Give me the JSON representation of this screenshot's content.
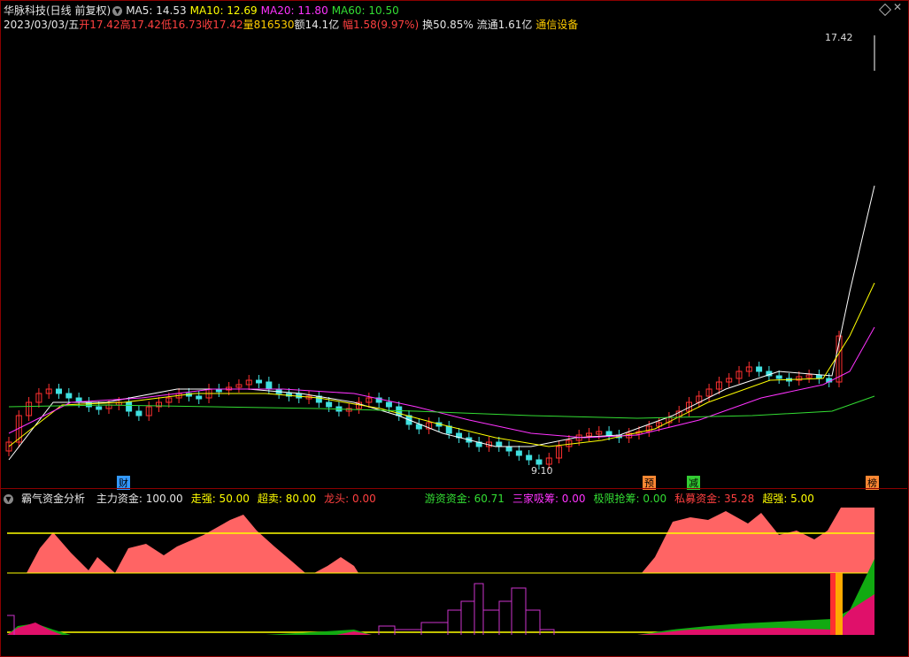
{
  "header": {
    "stock_title": "华脉科技(日线 前复权)",
    "ma5": "MA5: 14.53",
    "ma10": "MA10: 12.69",
    "ma20": "MA20: 11.80",
    "ma60": "MA60: 10.50",
    "date": "2023/03/03/五",
    "open": "开17.42",
    "high": "高17.42",
    "low": "低16.73",
    "close": "收17.42",
    "volume": "量816530",
    "amount": "额14.1亿",
    "change": "幅1.58(9.97%)",
    "turnover": "换50.85%",
    "float": "流通1.61亿",
    "sector": "通信设备"
  },
  "price_chart": {
    "high_label": "17.42",
    "low_label": "9.10",
    "markers": [
      {
        "text": "财",
        "color": "#3399ff"
      },
      {
        "text": "预",
        "color": "#ff8833"
      },
      {
        "text": "减",
        "color": "#33cc33"
      },
      {
        "text": "榜",
        "color": "#ff8833"
      }
    ]
  },
  "indicator": {
    "name": "霸气资金分析",
    "items": [
      {
        "text": "主力资金: 100.00",
        "color": "#e6e6e6"
      },
      {
        "text": "走强: 50.00",
        "color": "#ffff00"
      },
      {
        "text": "超卖: 80.00",
        "color": "#ffff00"
      },
      {
        "text": "龙头: 0.00",
        "color": "#ff3030"
      },
      {
        "text": "游资资金: 60.71",
        "color": "#33dd33"
      },
      {
        "text": "三家吸筹: 0.00",
        "color": "#ff33ff"
      },
      {
        "text": "极限抢筹: 0.00",
        "color": "#33dd33"
      },
      {
        "text": "私募资金: 35.28",
        "color": "#ff5555"
      },
      {
        "text": "超强: 5.00",
        "color": "#ffff00"
      }
    ]
  },
  "colors": {
    "up": "#ff3030",
    "down": "#40e0e0",
    "ma5": "#ffffff",
    "ma10": "#ffff00",
    "ma20": "#ff33ff",
    "ma60": "#33dd33"
  }
}
